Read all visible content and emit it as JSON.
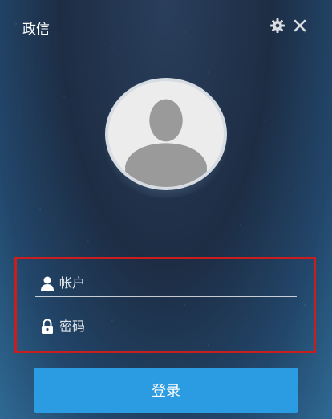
{
  "window": {
    "title": "政信"
  },
  "login": {
    "account_placeholder": "帐户",
    "password_placeholder": "密码",
    "account_value": "",
    "password_value": "",
    "submit_label": "登录"
  },
  "icons": {
    "settings": "gear-icon",
    "close": "close-icon",
    "account": "user-icon",
    "password": "lock-icon",
    "avatar": "user-silhouette-icon"
  },
  "colors": {
    "button": "#2b9be2",
    "highlight": "#c81e1e"
  }
}
